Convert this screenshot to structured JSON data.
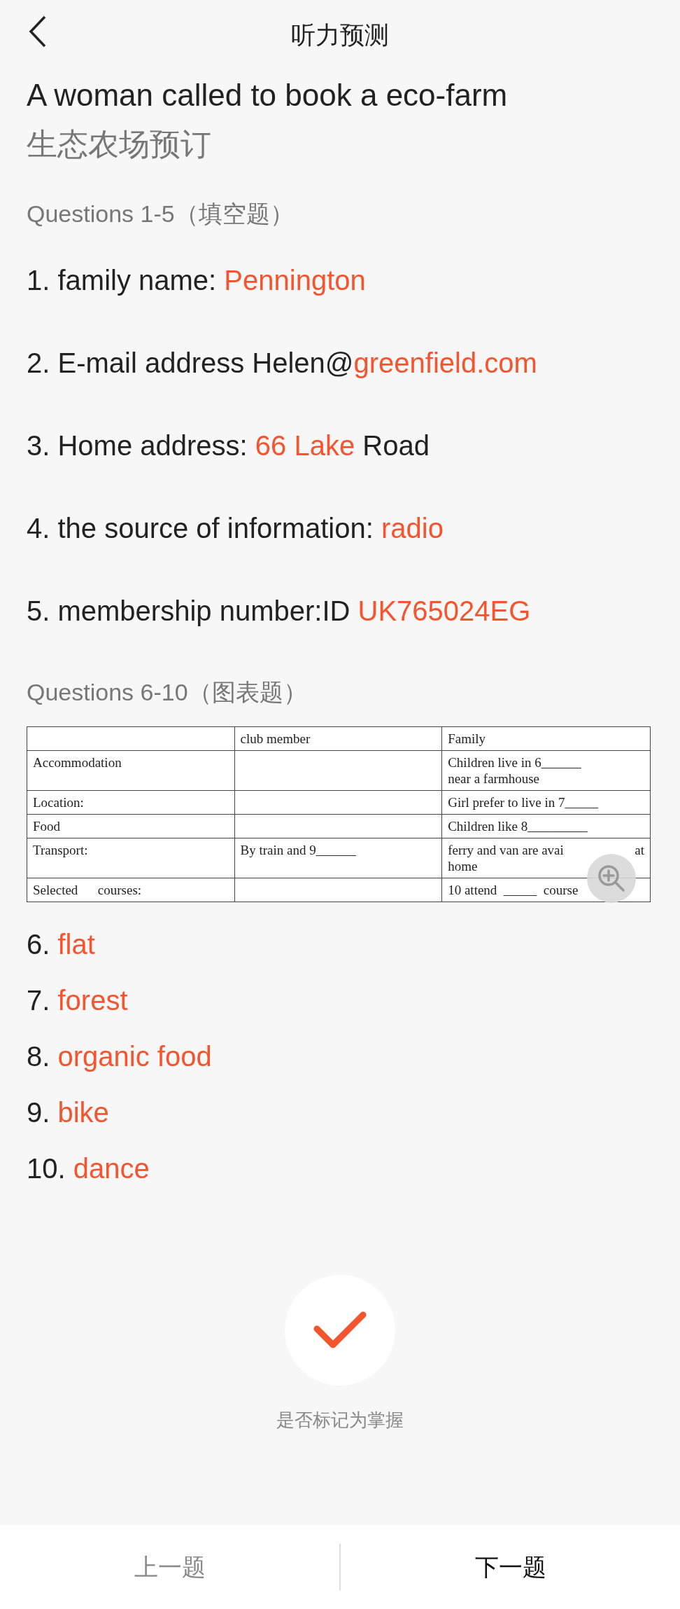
{
  "header": {
    "title": "听力预测"
  },
  "title": "A woman called to book a eco-farm",
  "subtitle": "生态农场预订",
  "section_1": {
    "heading": "Questions 1-5（填空题）",
    "items": [
      {
        "parts": [
          {
            "kind": "plain",
            "text": "1. family name: "
          },
          {
            "kind": "answer",
            "text": "Pennington"
          }
        ]
      },
      {
        "parts": [
          {
            "kind": "plain",
            "text": "2. E-mail address Helen@"
          },
          {
            "kind": "answer",
            "text": "greenfield.com"
          }
        ]
      },
      {
        "parts": [
          {
            "kind": "plain",
            "text": "3. Home address: "
          },
          {
            "kind": "answer",
            "text": "66 Lake"
          },
          {
            "kind": "plain",
            "text": " Road"
          }
        ]
      },
      {
        "parts": [
          {
            "kind": "plain",
            "text": "4. the source of information: "
          },
          {
            "kind": "answer",
            "text": "radio"
          }
        ]
      },
      {
        "parts": [
          {
            "kind": "plain",
            "text": "5. membership number:ID "
          },
          {
            "kind": "answer",
            "text": "UK765024EG"
          }
        ]
      }
    ]
  },
  "section_2": {
    "heading": "Questions 6-10（图表题）",
    "table": {
      "rows": [
        {
          "cells": [
            [],
            [
              "club member"
            ],
            [
              "Family"
            ]
          ]
        },
        {
          "cells": [
            [
              "Accommodation"
            ],
            [],
            [
              "Children live in 6______",
              "near a farmhouse"
            ]
          ]
        },
        {
          "cells": [
            [
              "Location:"
            ],
            [],
            [
              "Girl prefer to live in 7_____"
            ]
          ]
        },
        {
          "cells": [
            [
              "Food"
            ],
            [],
            [
              "Children like 8_________"
            ]
          ]
        },
        {
          "cells": [
            [
              "Transport:"
            ],
            [
              "By train and 9______"
            ],
            [
              "ferry and van are avai",
              "at",
              "home"
            ]
          ]
        },
        {
          "cells": [
            [
              "Selected      courses:"
            ],
            [],
            [
              "10 attend  _____  course"
            ]
          ]
        }
      ]
    },
    "answers": [
      {
        "number": "6.",
        "answer": "flat"
      },
      {
        "number": "7.",
        "answer": "forest"
      },
      {
        "number": "8.",
        "answer": "organic food"
      },
      {
        "number": "9.",
        "answer": "bike"
      },
      {
        "number": "10.",
        "answer": "dance"
      }
    ]
  },
  "mastered": {
    "checked": true,
    "label": "是否标记为掌握"
  },
  "nav": [
    {
      "label": "上一题",
      "selected": false
    },
    {
      "label": "下一题",
      "selected": true
    }
  ]
}
